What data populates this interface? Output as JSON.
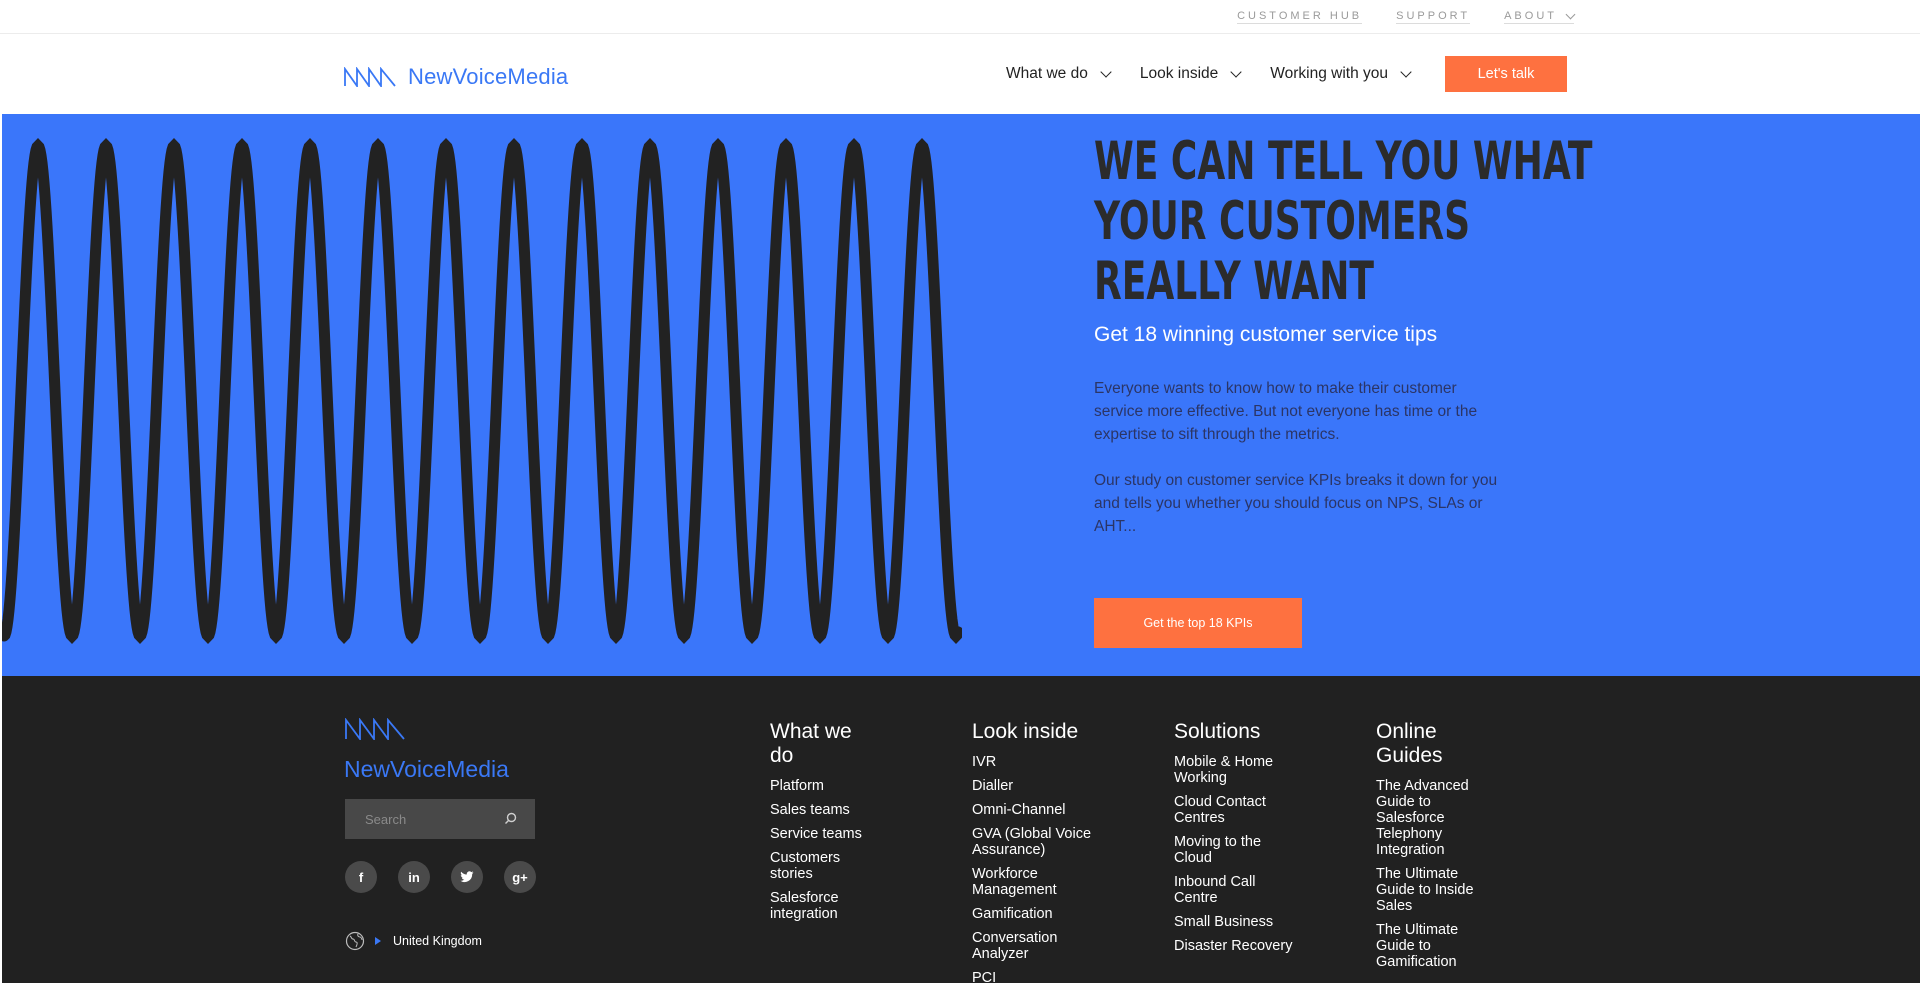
{
  "utility_nav": {
    "items": [
      "CUSTOMER HUB",
      "SUPPORT",
      "ABOUT"
    ]
  },
  "header": {
    "logo_text": "NewVoiceMedia",
    "nav": [
      {
        "label": "What we do"
      },
      {
        "label": "Look inside"
      },
      {
        "label": "Working with you"
      }
    ],
    "cta_label": "Let's talk"
  },
  "hero": {
    "headline_lines": [
      "WE CAN TELL YOU WHAT",
      "YOUR CUSTOMERS",
      "REALLY WANT"
    ],
    "subhead": "Get 18 winning customer service tips",
    "para1": "Everyone wants to know how to make their customer service more effective. But not everyone has time or the expertise to sift through the metrics.",
    "para2": "Our study on customer service KPIs breaks it down for you and tells you whether you should focus on NPS, SLAs or AHT...",
    "button_label": "Get the top 18 KPIs"
  },
  "footer": {
    "logo_text": "NewVoiceMedia",
    "search_placeholder": "Search",
    "socials": [
      "f",
      "in",
      "t",
      "g+"
    ],
    "region": "United Kingdom",
    "columns": [
      {
        "title": "What we do",
        "items": [
          "Platform",
          "Sales teams",
          "Service teams",
          "Customers stories",
          "Salesforce integration"
        ]
      },
      {
        "title": "Look inside",
        "items": [
          "IVR",
          "Dialler",
          "Omni-Channel",
          "GVA (Global Voice Assurance)",
          "Workforce Management",
          "Gamification",
          "Conversation Analyzer",
          "PCI"
        ]
      },
      {
        "title": "Solutions",
        "items": [
          "Mobile & Home Working",
          "Cloud Contact Centres",
          "Moving to the Cloud",
          "Inbound Call Centre",
          "Small Business",
          "Disaster Recovery"
        ]
      },
      {
        "title": "Online Guides",
        "items": [
          "The Advanced Guide to Salesforce Telephony Integration",
          "The Ultimate Guide to Inside Sales",
          "The Ultimate Guide to Gamification"
        ]
      }
    ]
  },
  "colors": {
    "brand_blue": "#3a76fa",
    "accent_orange": "#fe7140",
    "footer_bg": "#212121"
  }
}
